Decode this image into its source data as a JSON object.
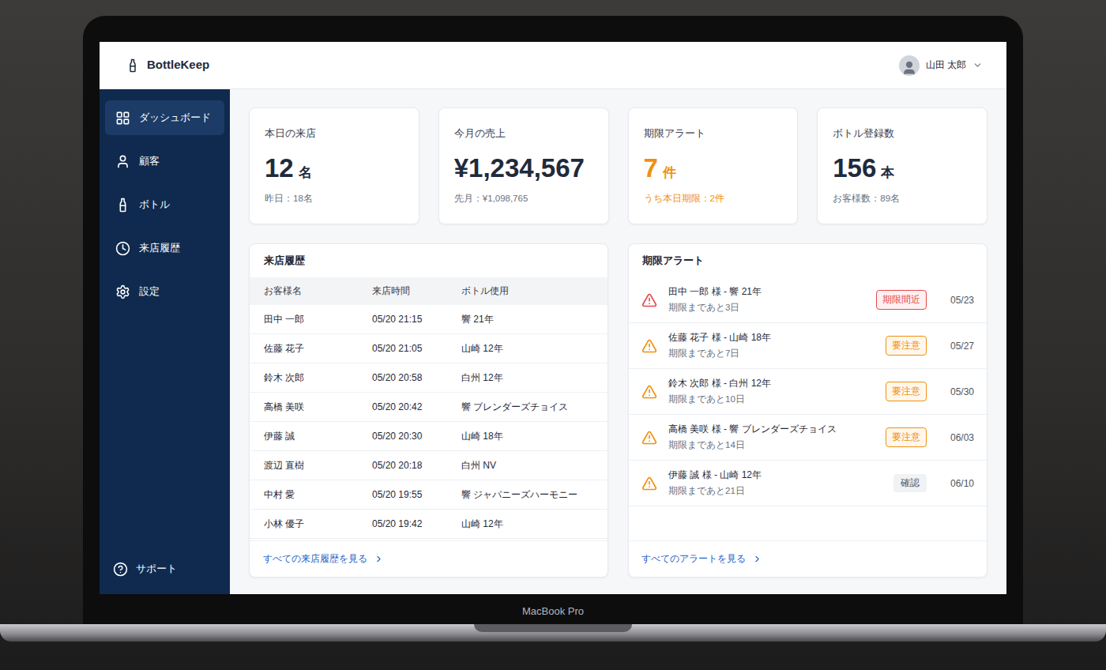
{
  "device": {
    "label": "MacBook Pro"
  },
  "app": {
    "name": "BottleKeep"
  },
  "user": {
    "name": "山田 太郎"
  },
  "sidebar": {
    "items": [
      {
        "label": "ダッシュボード",
        "selected": true
      },
      {
        "label": "顧客",
        "selected": false
      },
      {
        "label": "ボトル",
        "selected": false
      },
      {
        "label": "来店履歴",
        "selected": false
      },
      {
        "label": "設定",
        "selected": false
      }
    ],
    "support": "サポート"
  },
  "stats": [
    {
      "title": "本日の来店",
      "value": "12",
      "unit": "名",
      "sub": "昨日：18名",
      "color": "#1f2a3c",
      "sub_color": "#6b7280"
    },
    {
      "title": "今月の売上",
      "value": "¥1,234,567",
      "unit": "",
      "sub": "先月：¥1,098,765",
      "color": "#1f2a3c",
      "sub_color": "#6b7280"
    },
    {
      "title": "期限アラート",
      "value": "7",
      "unit": "件",
      "sub": "うち本日期限：2件",
      "color": "#f0900f",
      "sub_color": "#f0900f"
    },
    {
      "title": "ボトル登録数",
      "value": "156",
      "unit": "本",
      "sub": "お客様数：89名",
      "color": "#1f2a3c",
      "sub_color": "#6b7280"
    }
  ],
  "visits": {
    "title": "来店履歴",
    "columns": [
      "お客様名",
      "来店時間",
      "ボトル使用"
    ],
    "rows": [
      [
        "田中 一郎",
        "05/20 21:15",
        "響 21年"
      ],
      [
        "佐藤 花子",
        "05/20 21:05",
        "山崎 12年"
      ],
      [
        "鈴木 次郎",
        "05/20 20:58",
        "白州 12年"
      ],
      [
        "高橋 美咲",
        "05/20 20:42",
        "響 ブレンダーズチョイス"
      ],
      [
        "伊藤 誠",
        "05/20 20:30",
        "山崎 18年"
      ],
      [
        "渡辺 直樹",
        "05/20 20:18",
        "白州 NV"
      ],
      [
        "中村 愛",
        "05/20 19:55",
        "響 ジャパニーズハーモニー"
      ],
      [
        "小林 優子",
        "05/20 19:42",
        "山崎 12年"
      ]
    ],
    "link": "すべての来店履歴を見る"
  },
  "alerts": {
    "title": "期限アラート",
    "items": [
      {
        "text": "田中 一郎 様 - 響 21年",
        "sub": "期限まであと3日",
        "badge": "期限間近",
        "date": "05/23",
        "kind": "danger",
        "color": "#e5484d"
      },
      {
        "text": "佐藤 花子 様 - 山崎 18年",
        "sub": "期限まであと7日",
        "badge": "要注意",
        "date": "05/27",
        "kind": "warning",
        "color": "#f0900f"
      },
      {
        "text": "鈴木 次郎 様 - 白州 12年",
        "sub": "期限まであと10日",
        "badge": "要注意",
        "date": "05/30",
        "kind": "warning",
        "color": "#f0900f"
      },
      {
        "text": "高橋 美咲 様 - 響 ブレンダーズチョイス",
        "sub": "期限まであと14日",
        "badge": "要注意",
        "date": "06/03",
        "kind": "warning",
        "color": "#f0900f"
      },
      {
        "text": "伊藤 誠 様 - 山崎 12年",
        "sub": "期限まであと21日",
        "badge": "確認",
        "date": "06/10",
        "kind": "neutral",
        "color": "#f0900f"
      }
    ],
    "link": "すべてのアラートを見る"
  }
}
